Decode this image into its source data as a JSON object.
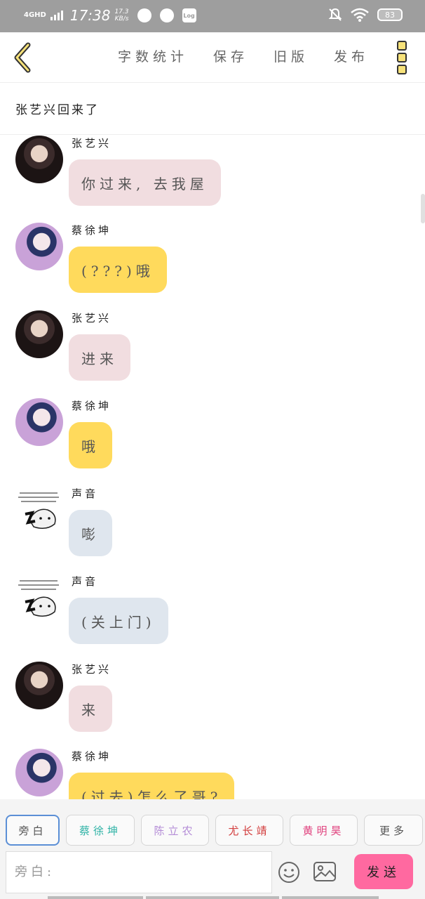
{
  "status_bar": {
    "network": "4GHD",
    "time": "17:38",
    "speed_value": "17.3",
    "speed_unit": "KB/s",
    "app_log_label": "Log",
    "battery": "83"
  },
  "nav": {
    "actions": [
      "字数统计",
      "保存",
      "旧版",
      "发布"
    ]
  },
  "title": "张艺兴回来了",
  "messages": [
    {
      "speaker": "张艺兴",
      "text": "你过来, 去我屋",
      "avatar": "zhang",
      "style": "pink"
    },
    {
      "speaker": "蔡徐坤",
      "text": "(???)哦",
      "avatar": "cai",
      "style": "yellow"
    },
    {
      "speaker": "张艺兴",
      "text": "进来",
      "avatar": "zhang",
      "style": "pink"
    },
    {
      "speaker": "蔡徐坤",
      "text": "哦",
      "avatar": "cai",
      "style": "yellow"
    },
    {
      "speaker": "声音",
      "text": "嘭",
      "avatar": "voice",
      "style": "grey"
    },
    {
      "speaker": "声音",
      "text": "(关上门)",
      "avatar": "voice",
      "style": "grey"
    },
    {
      "speaker": "张艺兴",
      "text": "来",
      "avatar": "zhang",
      "style": "pink"
    },
    {
      "speaker": "蔡徐坤",
      "text": "(过去)怎么了哥?",
      "avatar": "cai",
      "style": "yellow"
    }
  ],
  "chips": [
    {
      "label": "旁白",
      "color": "#555555"
    },
    {
      "label": "蔡徐坤",
      "color": "#2fb3a6"
    },
    {
      "label": "陈立农",
      "color": "#b38bd6"
    },
    {
      "label": "尤长靖",
      "color": "#d23b3b"
    },
    {
      "label": "黄明昊",
      "color": "#e0437f"
    },
    {
      "label": "更多",
      "color": "#555555"
    }
  ],
  "input": {
    "placeholder": "旁白:"
  },
  "send_label": "发送",
  "colors": {
    "bubble_pink": "#f1dde0",
    "bubble_yellow": "#ffda5c",
    "bubble_grey": "#dfe6ee",
    "send_button": "#ff69a0"
  }
}
